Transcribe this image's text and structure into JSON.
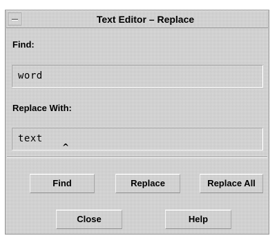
{
  "window": {
    "title": "Text Editor – Replace"
  },
  "find": {
    "label": "Find:",
    "value": "word"
  },
  "replace": {
    "label": "Replace With:",
    "value": "text"
  },
  "buttons": {
    "find": "Find",
    "replace": "Replace",
    "replace_all": "Replace All",
    "close": "Close",
    "help": "Help"
  },
  "icons": {
    "window_menu": "window-menu-icon",
    "text_caret": "text-caret-icon"
  }
}
